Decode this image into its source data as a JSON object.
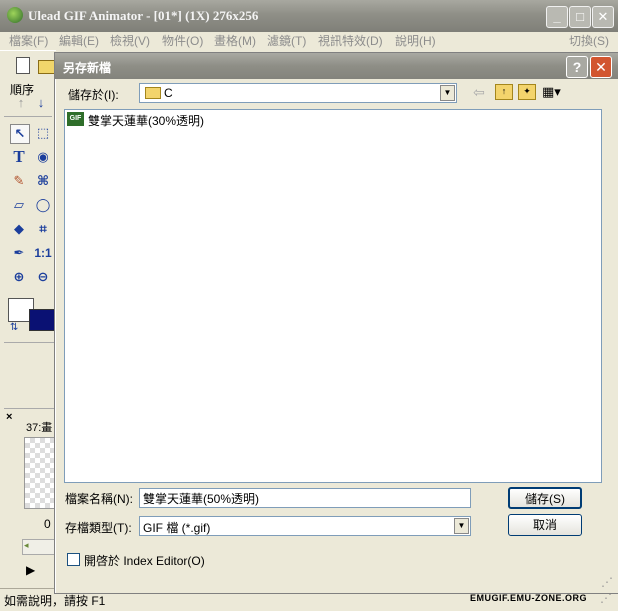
{
  "window": {
    "title": "Ulead GIF Animator - [01*] (1X) 276x256",
    "min_glyph": "_",
    "max_glyph": "□",
    "close_glyph": "✕"
  },
  "menu": {
    "items": [
      "檔案(F)",
      "編輯(E)",
      "檢視(V)",
      "物件(O)",
      "畫格(M)",
      "濾鏡(T)",
      "視訊特效(D)",
      "說明(H)"
    ],
    "switch_label": "切換(S)"
  },
  "left_panel": {
    "sequence_label": "順序",
    "zoom_label": "1:1",
    "frame_label": "37:畫",
    "frame_number": "0"
  },
  "dialog": {
    "title": "另存新檔",
    "help_glyph": "?",
    "close_glyph": "✕",
    "save_in_label": "儲存於(I):",
    "save_in_value": "C",
    "files": [
      {
        "name": "雙掌天蓮華(30%透明)",
        "badge": "GIF"
      }
    ],
    "filename_label": "檔案名稱(N):",
    "filename_value": "雙掌天蓮華(50%透明)",
    "filetype_label": "存檔類型(T):",
    "filetype_value": "GIF 檔 (*.gif)",
    "save_button": "儲存(S)",
    "cancel_button": "取消",
    "open_in_index_editor_label": "開啓於 Index Editor(O)",
    "open_in_index_editor_checked": false
  },
  "status": {
    "help_text": "如需說明，請按 F1",
    "watermark": "EMUGIF.EMU-ZONE.ORG"
  },
  "colors": {
    "foreground_swatch": "#ffffff",
    "background_swatch": "#0a1173",
    "tool_blue": "#1b3e9c"
  }
}
